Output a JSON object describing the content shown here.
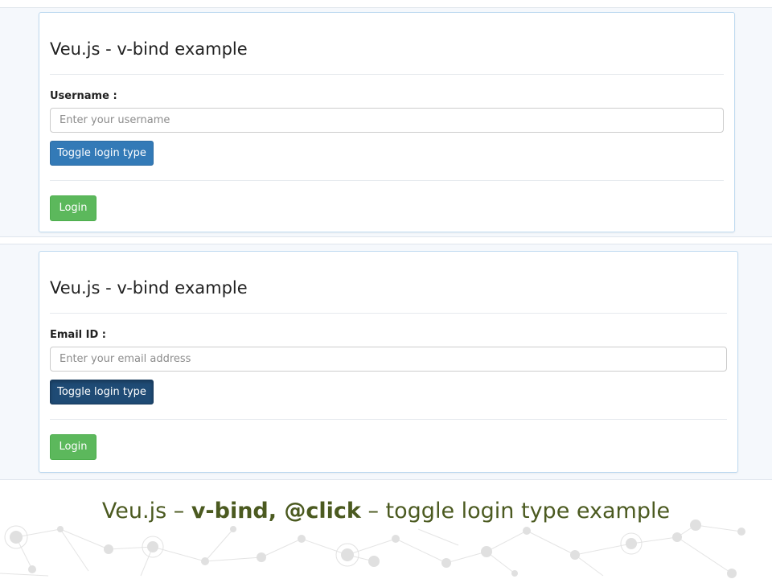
{
  "panels": [
    {
      "title": "Veu.js - v-bind example",
      "field_label": "Username :",
      "input_value": "",
      "input_placeholder": "Enter your username",
      "toggle_label": "Toggle login type",
      "toggle_state": "normal",
      "login_label": "Login"
    },
    {
      "title": "Veu.js - v-bind example",
      "field_label": "Email ID :",
      "input_value": "",
      "input_placeholder": "Enter your email address",
      "toggle_label": "Toggle login type",
      "toggle_state": "pressed",
      "login_label": "Login"
    }
  ],
  "caption": {
    "part1": "Veu.js – ",
    "part2": "v-bind, @click",
    "part3": " – toggle login type example"
  },
  "colors": {
    "primary_button": "#337ab7",
    "primary_button_pressed": "#1f4b75",
    "success_button": "#5cb85c",
    "panel_border": "#bfdaf0",
    "caption_text": "#4b5a20"
  }
}
